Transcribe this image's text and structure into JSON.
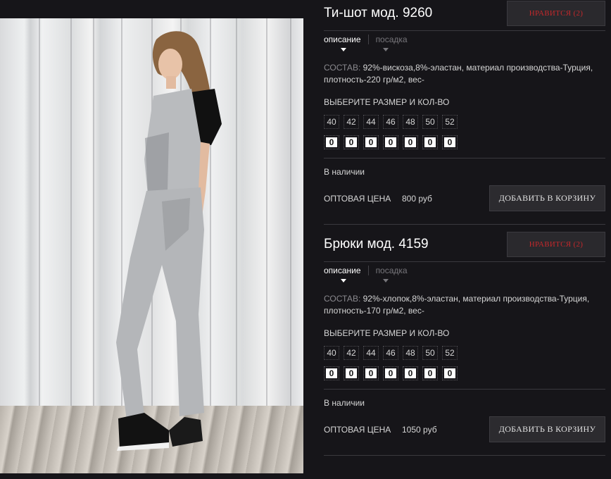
{
  "products": [
    {
      "title": "Ти-шот мод. 9260",
      "like_label": "НРАВИТСЯ (2)",
      "tabs": [
        "описание",
        "посадка"
      ],
      "composition_label": "СОСТАВ:",
      "composition_text": "92%-вискоза,8%-эластан, материал производства-Турция, плотность-220 гр/м2, вес-",
      "sizes_label": "ВЫБЕРИТЕ РАЗМЕР И КОЛ-ВО",
      "sizes": [
        "40",
        "42",
        "44",
        "46",
        "48",
        "50",
        "52"
      ],
      "quantities": [
        "0",
        "0",
        "0",
        "0",
        "0",
        "0",
        "0"
      ],
      "stock": "В наличии",
      "price_label": "ОПТОВАЯ ЦЕНА",
      "price": "800 руб",
      "cart_label": "ДОБАВИТЬ В КОРЗИНУ"
    },
    {
      "title": "Брюки мод. 4159",
      "like_label": "НРАВИТСЯ (2)",
      "tabs": [
        "описание",
        "посадка"
      ],
      "composition_label": "СОСТАВ:",
      "composition_text": "92%-хлопок,8%-эластан, материал производства-Турция, плотность-170 гр/м2, вес-",
      "sizes_label": "ВЫБЕРИТЕ РАЗМЕР И КОЛ-ВО",
      "sizes": [
        "40",
        "42",
        "44",
        "46",
        "48",
        "50",
        "52"
      ],
      "quantities": [
        "0",
        "0",
        "0",
        "0",
        "0",
        "0",
        "0"
      ],
      "stock": "В наличии",
      "price_label": "ОПТОВАЯ ЦЕНА",
      "price": "1050 руб",
      "cart_label": "ДОБАВИТЬ В КОРЗИНУ"
    }
  ],
  "colors": {
    "background": "#161519",
    "accent_like": "#c3282b",
    "button_bg": "#2c2b2f"
  }
}
